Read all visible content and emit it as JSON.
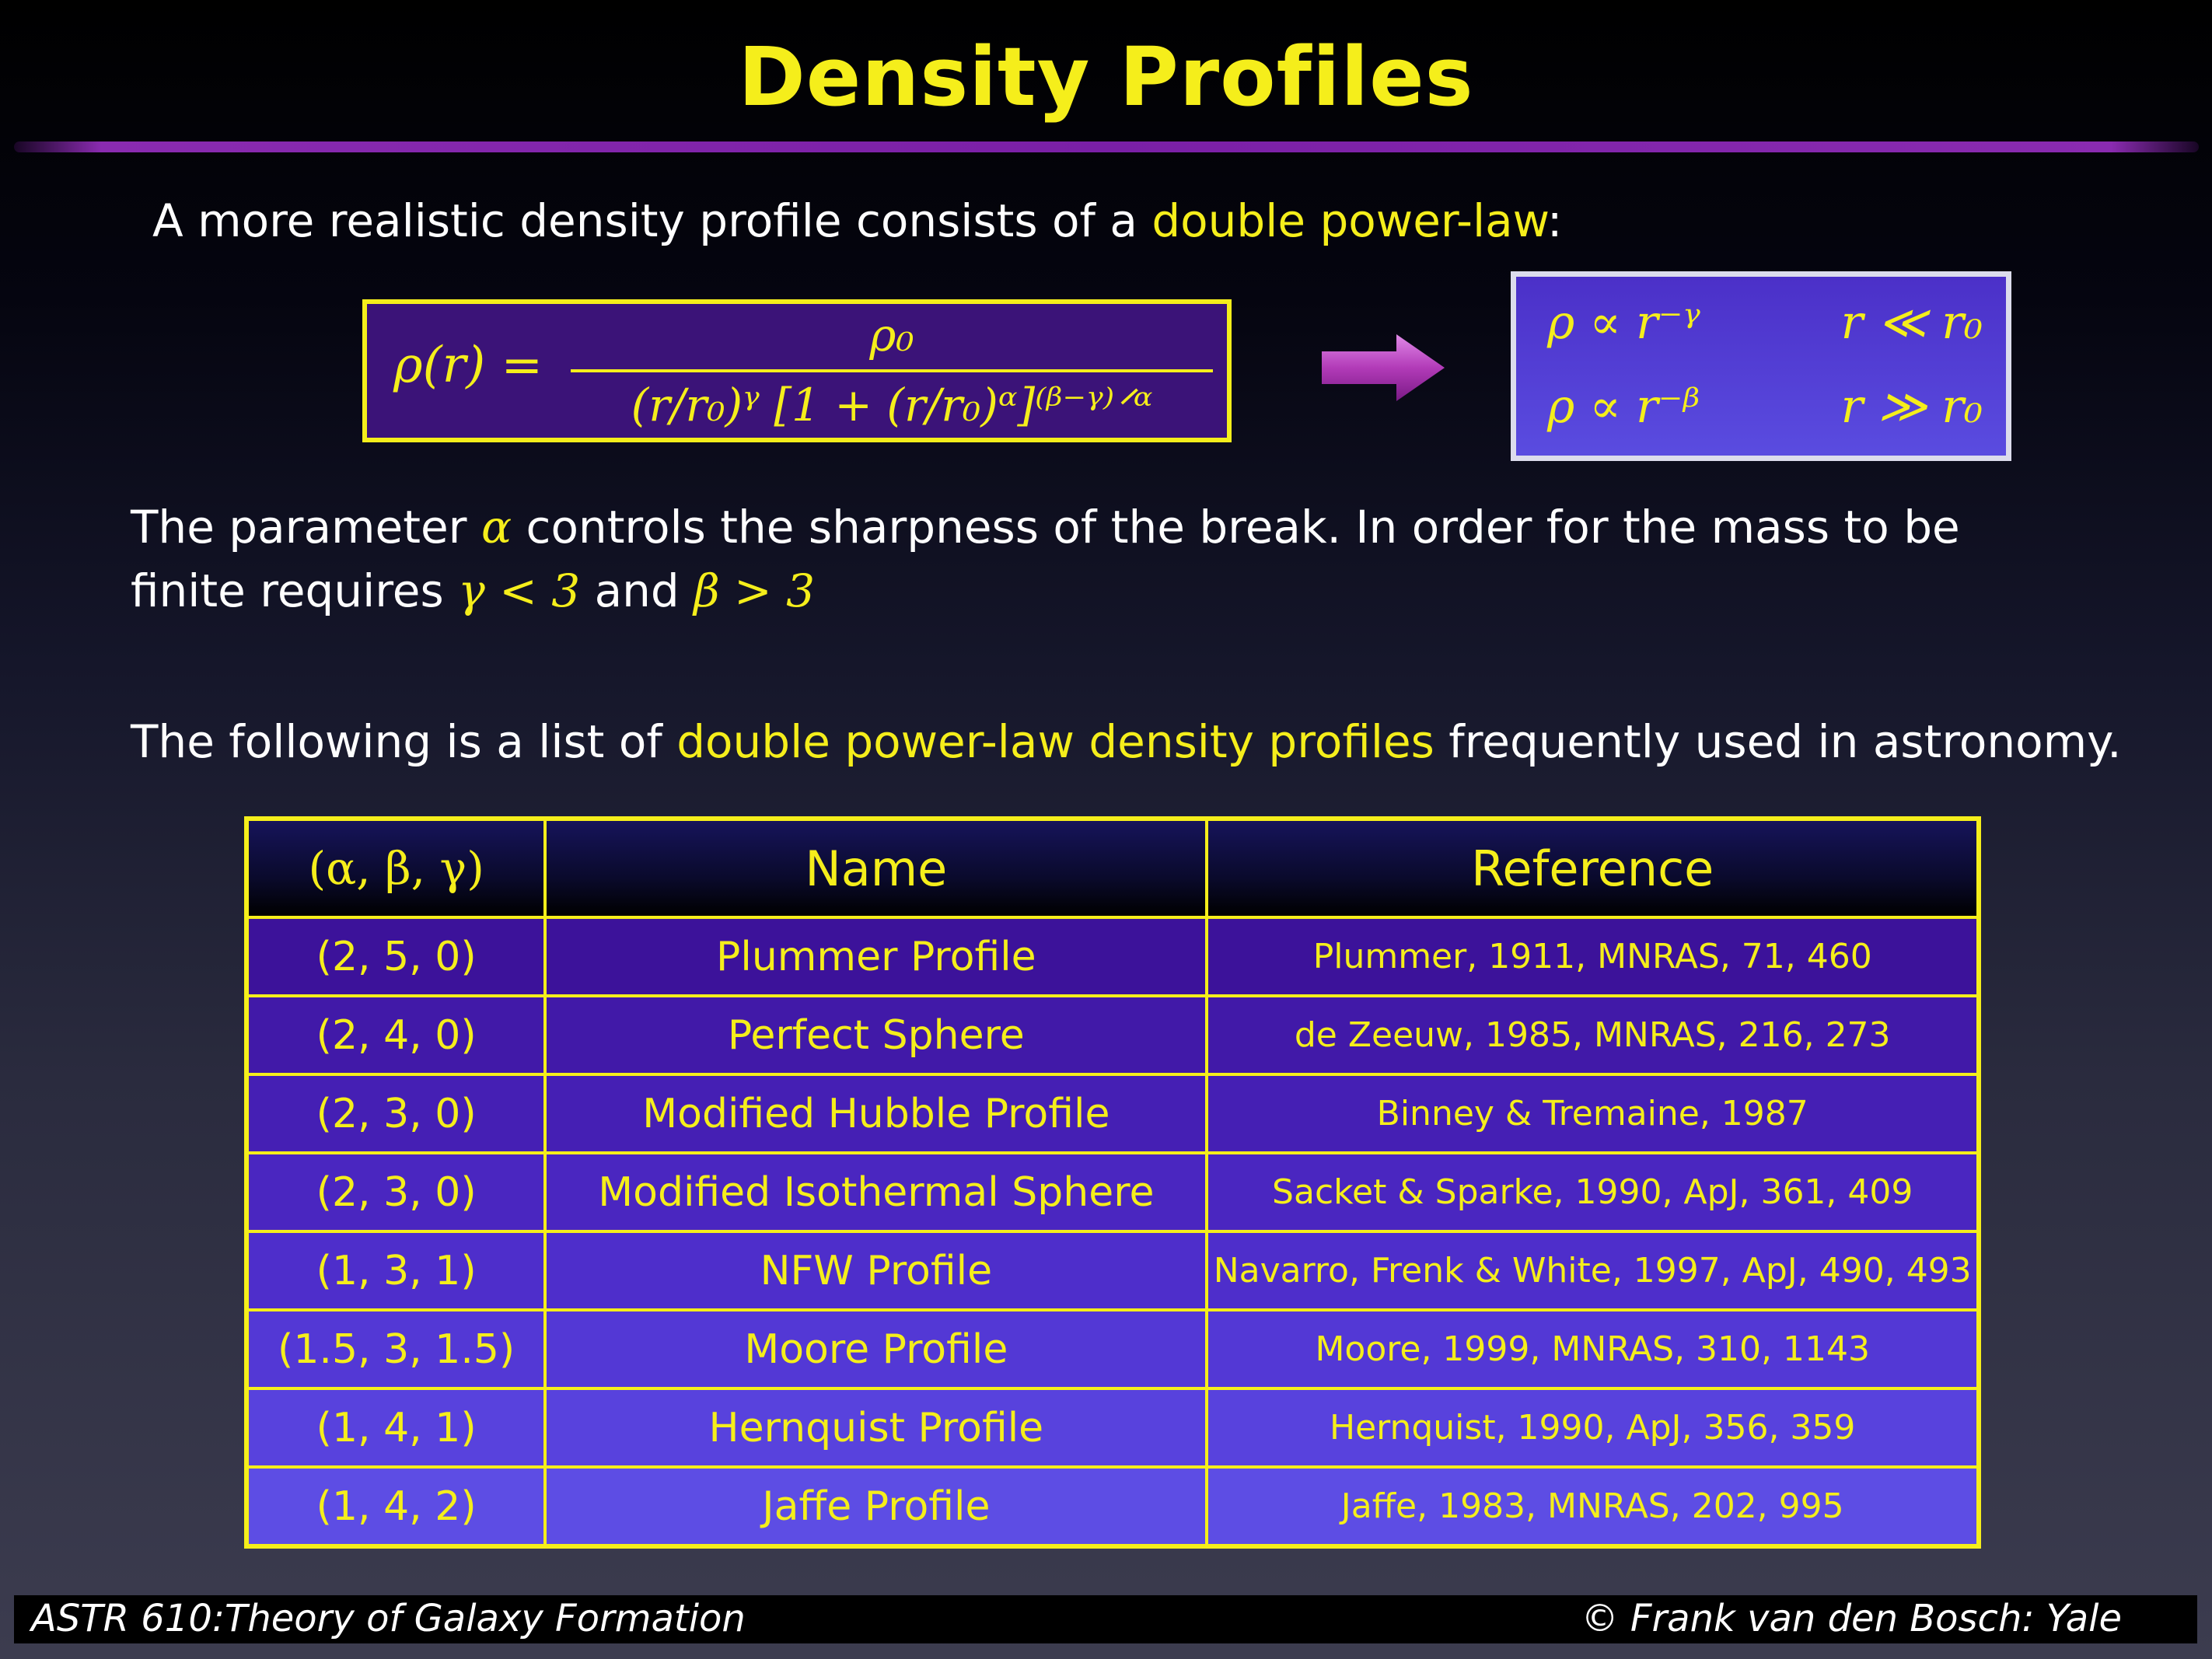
{
  "title": "Density Profiles",
  "intro": {
    "before": "A more realistic density profile consists of a ",
    "highlight": "double power-law",
    "after": ":"
  },
  "formula": {
    "lhs": "ρ(r) =",
    "numerator": "ρ₀",
    "denominator": "(r/r₀)ᵞ [1 + (r/r₀)ᵅ]⁽ᵝ⁻ᵞ⁾ᐟᵅ"
  },
  "asymptotes": [
    {
      "relation": "ρ ∝ r⁻ᵞ",
      "condition": "r ≪ r₀"
    },
    {
      "relation": "ρ ∝ r⁻ᵝ",
      "condition": "r ≫ r₀"
    }
  ],
  "param_text": {
    "line1_a": "The parameter ",
    "alpha": "α",
    "line1_b": " controls the sharpness of the break. In order for the mass to be",
    "line2_a": "finite requires ",
    "gamma_cond": "γ < 3",
    "line2_b": " and ",
    "beta_cond": "β > 3"
  },
  "list_text": {
    "before": "The following is a list of ",
    "highlight": "double power-law density profiles",
    "after": " frequently used in astronomy."
  },
  "table": {
    "headers": [
      "(α, β, γ)",
      "Name",
      "Reference"
    ],
    "rows": [
      {
        "params": "(2, 5, 0)",
        "name": "Plummer Profile",
        "ref": "Plummer, 1911, MNRAS, 71, 460"
      },
      {
        "params": "(2, 4, 0)",
        "name": "Perfect Sphere",
        "ref": "de Zeeuw, 1985, MNRAS, 216, 273"
      },
      {
        "params": "(2, 3, 0)",
        "name": "Modified Hubble Profile",
        "ref": "Binney & Tremaine, 1987"
      },
      {
        "params": "(2, 3, 0)",
        "name": "Modified Isothermal Sphere",
        "ref": "Sacket & Sparke, 1990, ApJ, 361, 409"
      },
      {
        "params": "(1, 3, 1)",
        "name": "NFW Profile",
        "ref": "Navarro, Frenk & White, 1997, ApJ, 490, 493"
      },
      {
        "params": "(1.5, 3, 1.5)",
        "name": "Moore Profile",
        "ref": "Moore, 1999, MNRAS, 310, 1143"
      },
      {
        "params": "(1, 4, 1)",
        "name": "Hernquist Profile",
        "ref": "Hernquist, 1990, ApJ, 356, 359"
      },
      {
        "params": "(1, 4, 2)",
        "name": "Jaffe Profile",
        "ref": "Jaffe, 1983, MNRAS, 202, 995"
      }
    ],
    "row_colors": [
      "#3c129a",
      "#4119a8",
      "#451fb4",
      "#4a26c0",
      "#4e2ecb",
      "#5338d5",
      "#5842dd",
      "#5d4de4"
    ]
  },
  "footer": {
    "left": "ASTR 610:Theory of Galaxy Formation",
    "right": "© Frank van den Bosch: Yale"
  },
  "colors": {
    "accent": "#f5ee1b",
    "rule": "#7a1fa6"
  }
}
